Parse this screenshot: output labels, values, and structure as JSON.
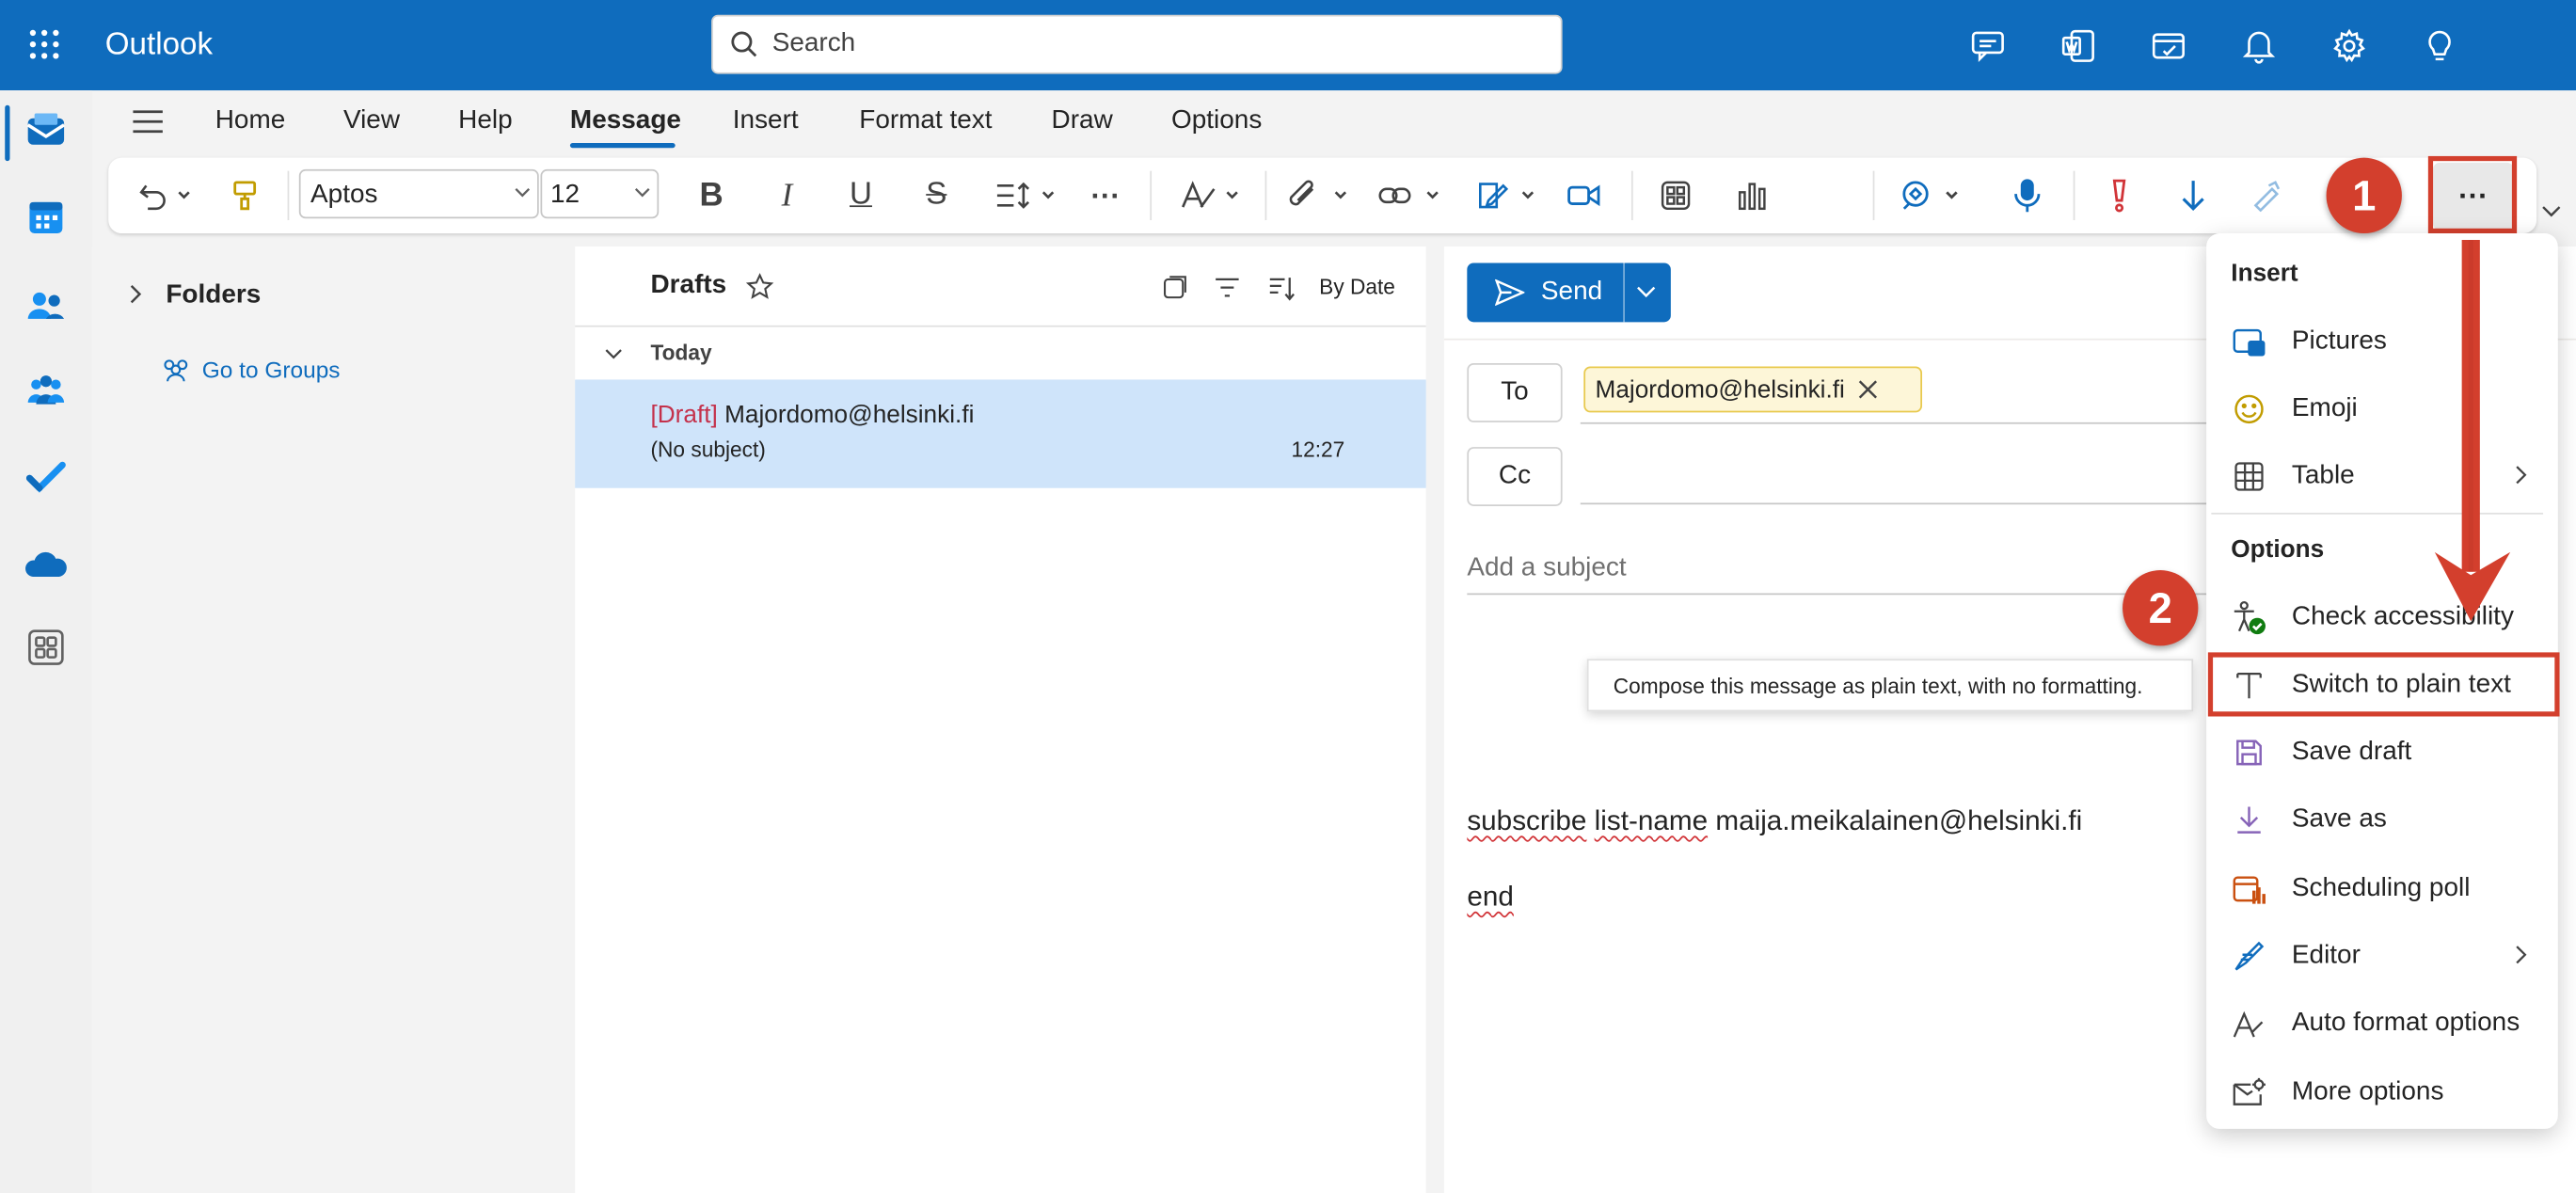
{
  "app": {
    "title": "Outlook"
  },
  "search": {
    "placeholder": "Search"
  },
  "nav_tabs": [
    "Home",
    "View",
    "Help",
    "Message",
    "Insert",
    "Format text",
    "Draw",
    "Options"
  ],
  "nav_active": "Message",
  "ribbon": {
    "font": "Aptos",
    "size": "12",
    "more_label": "···"
  },
  "folders": {
    "label": "Folders",
    "groups_link": "Go to Groups"
  },
  "maillist": {
    "title": "Drafts",
    "sort_label": "By Date",
    "group_label": "Today",
    "items": [
      {
        "tag": "[Draft]",
        "sender": "Majordomo@helsinki.fi",
        "subject": "(No subject)",
        "time": "12:27"
      }
    ]
  },
  "compose": {
    "send_label": "Send",
    "to_label": "To",
    "cc_label": "Cc",
    "recipient": "Majordomo@helsinki.fi",
    "subject_placeholder": "Add a subject",
    "body_word1": "subscribe",
    "body_word2": "list-name",
    "body_rest": "maija.meikalainen@helsinki.fi",
    "body_end": "end"
  },
  "menu": {
    "insert_header": "Insert",
    "insert_items": [
      "Pictures",
      "Emoji",
      "Table"
    ],
    "options_header": "Options",
    "option_items": [
      "Check accessibility",
      "Switch to plain text",
      "Save draft",
      "Save as",
      "Scheduling poll",
      "Editor",
      "Auto format options",
      "More options"
    ]
  },
  "tooltip": {
    "text": "Compose this message as plain text, with no formatting."
  },
  "annotations": {
    "step1": "1",
    "step2": "2"
  },
  "colors": {
    "brand": "#0f6cbd",
    "annotation_red": "#d33f2d",
    "draft_red": "#c4314b",
    "selected_row": "#cfe4fa"
  }
}
